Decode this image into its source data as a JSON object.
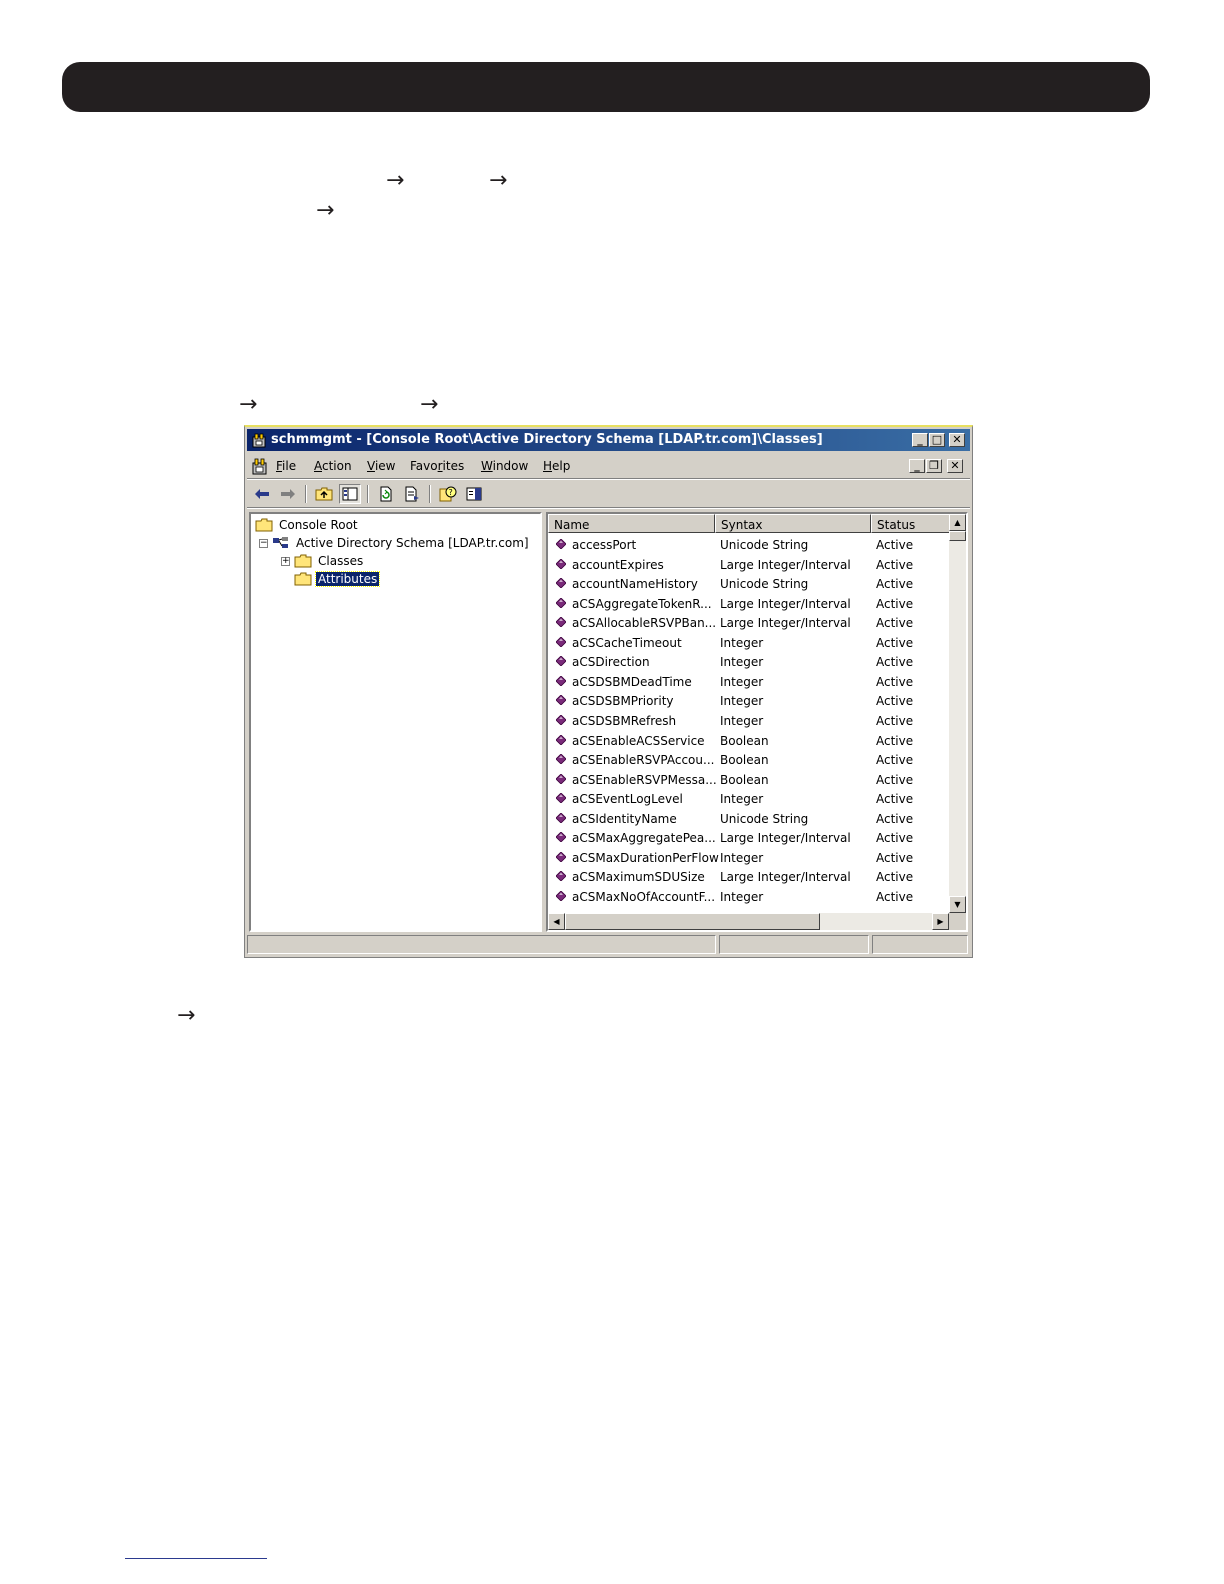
{
  "window": {
    "title": "schmmgmt - [Console Root\\Active Directory Schema [LDAP.tr.com]\\Classes]",
    "controls": {
      "minimize": "_",
      "maximize": "□",
      "close": "✕"
    },
    "mdi_controls": {
      "minimize": "_",
      "restore": "❐",
      "close": "✕"
    }
  },
  "menu": [
    {
      "accel": "F",
      "rest": "ile"
    },
    {
      "accel": "A",
      "rest": "ction"
    },
    {
      "accel": "V",
      "rest": "iew"
    },
    {
      "pre": "Favo",
      "accel": "r",
      "rest": "ites"
    },
    {
      "accel": "W",
      "rest": "indow"
    },
    {
      "accel": "H",
      "rest": "elp"
    }
  ],
  "tree": {
    "root": "Console Root",
    "schema": "Active Directory Schema [LDAP.tr.com]",
    "classes": "Classes",
    "attributes": "Attributes",
    "expander_minus": "−",
    "expander_plus": "+"
  },
  "list": {
    "columns": {
      "name": "Name",
      "syntax": "Syntax",
      "status": "Status"
    },
    "rows": [
      {
        "name": "accessPort",
        "syntax": "Unicode String",
        "status": "Active"
      },
      {
        "name": "accountExpires",
        "syntax": "Large Integer/Interval",
        "status": "Active"
      },
      {
        "name": "accountNameHistory",
        "syntax": "Unicode String",
        "status": "Active"
      },
      {
        "name": "aCSAggregateTokenR...",
        "syntax": "Large Integer/Interval",
        "status": "Active"
      },
      {
        "name": "aCSAllocableRSVPBan...",
        "syntax": "Large Integer/Interval",
        "status": "Active"
      },
      {
        "name": "aCSCacheTimeout",
        "syntax": "Integer",
        "status": "Active"
      },
      {
        "name": "aCSDirection",
        "syntax": "Integer",
        "status": "Active"
      },
      {
        "name": "aCSDSBMDeadTime",
        "syntax": "Integer",
        "status": "Active"
      },
      {
        "name": "aCSDSBMPriority",
        "syntax": "Integer",
        "status": "Active"
      },
      {
        "name": "aCSDSBMRefresh",
        "syntax": "Integer",
        "status": "Active"
      },
      {
        "name": "aCSEnableACSService",
        "syntax": "Boolean",
        "status": "Active"
      },
      {
        "name": "aCSEnableRSVPAccou...",
        "syntax": "Boolean",
        "status": "Active"
      },
      {
        "name": "aCSEnableRSVPMessa...",
        "syntax": "Boolean",
        "status": "Active"
      },
      {
        "name": "aCSEventLogLevel",
        "syntax": "Integer",
        "status": "Active"
      },
      {
        "name": "aCSIdentityName",
        "syntax": "Unicode String",
        "status": "Active"
      },
      {
        "name": "aCSMaxAggregatePea...",
        "syntax": "Large Integer/Interval",
        "status": "Active"
      },
      {
        "name": "aCSMaxDurationPerFlow",
        "syntax": "Integer",
        "status": "Active"
      },
      {
        "name": "aCSMaximumSDUSize",
        "syntax": "Large Integer/Interval",
        "status": "Active"
      },
      {
        "name": "aCSMaxNoOfAccountF...",
        "syntax": "Integer",
        "status": "Active"
      }
    ]
  },
  "scroll_glyphs": {
    "up": "▲",
    "down": "▼",
    "left": "◀",
    "right": "▶"
  },
  "doc_arrows": "→",
  "colors": {
    "header_bar": "#231f20",
    "title_gradient_start": "#0a246a",
    "title_gradient_end": "#3a6ea5",
    "attribute_icon": "#7a2a7a"
  }
}
